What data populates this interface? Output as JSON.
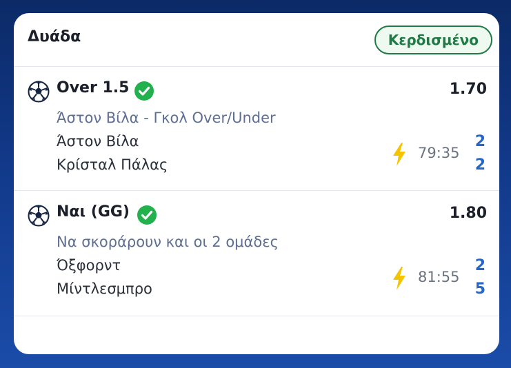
{
  "card": {
    "title": "Δυάδα",
    "status": "Κερδισμένο"
  },
  "selections": [
    {
      "market": "Over 1.5",
      "odds": "1.70",
      "subtitle": "Άστον Βίλα - Γκολ Over/Under",
      "home_team": "Άστον Βίλα",
      "away_team": "Κρίσταλ Πάλας",
      "minute": "79:35",
      "home_score": "2",
      "away_score": "2"
    },
    {
      "market": "Ναι (GG)",
      "odds": "1.80",
      "subtitle": "Να σκοράρουν και οι 2 ομάδες",
      "home_team": "Όξφορντ",
      "away_team": "Μίντλεσμπρο",
      "minute": "81:55",
      "home_score": "2",
      "away_score": "5"
    }
  ],
  "icons": {
    "sport": "soccer-ball-icon",
    "won": "check-circle-icon",
    "live": "lightning-bolt-icon"
  },
  "colors": {
    "won_green": "#1f7a45",
    "check_green": "#22b14c",
    "score_blue": "#2566c9",
    "bolt_yellow": "#f5c400",
    "background_blue": "#12398a"
  }
}
